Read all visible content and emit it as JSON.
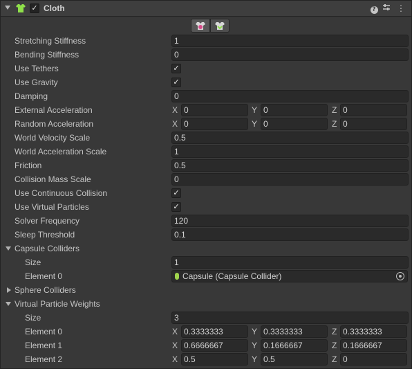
{
  "component": {
    "title": "Cloth",
    "enabled": true,
    "check_glyph": "✓",
    "icons": [
      "cloth-component-icon",
      "help-icon",
      "presets-icon",
      "more-menu-icon"
    ],
    "toolbar": [
      "edit-constraints-icon",
      "edit-self-collision-icon"
    ]
  },
  "axes": {
    "x": "X",
    "y": "Y",
    "z": "Z"
  },
  "props": {
    "stretching_stiffness": {
      "label": "Stretching Stiffness",
      "value": "1"
    },
    "bending_stiffness": {
      "label": "Bending Stiffness",
      "value": "0"
    },
    "use_tethers": {
      "label": "Use Tethers",
      "checked": true
    },
    "use_gravity": {
      "label": "Use Gravity",
      "checked": true
    },
    "damping": {
      "label": "Damping",
      "value": "0"
    },
    "external_acceleration": {
      "label": "External Acceleration",
      "x": "0",
      "y": "0",
      "z": "0"
    },
    "random_acceleration": {
      "label": "Random Acceleration",
      "x": "0",
      "y": "0",
      "z": "0"
    },
    "world_velocity_scale": {
      "label": "World Velocity Scale",
      "value": "0.5"
    },
    "world_acceleration_scale": {
      "label": "World Acceleration Scale",
      "value": "1"
    },
    "friction": {
      "label": "Friction",
      "value": "0.5"
    },
    "collision_mass_scale": {
      "label": "Collision Mass Scale",
      "value": "0"
    },
    "use_continuous_collision": {
      "label": "Use Continuous Collision",
      "checked": true
    },
    "use_virtual_particles": {
      "label": "Use Virtual Particles",
      "checked": true
    },
    "solver_frequency": {
      "label": "Solver Frequency",
      "value": "120"
    },
    "sleep_threshold": {
      "label": "Sleep Threshold",
      "value": "0.1"
    }
  },
  "capsule_colliders": {
    "label": "Capsule Colliders",
    "expanded": true,
    "size_label": "Size",
    "size": "1",
    "elements": [
      {
        "label": "Element 0",
        "value": "Capsule (Capsule Collider)"
      }
    ]
  },
  "sphere_colliders": {
    "label": "Sphere Colliders",
    "expanded": false
  },
  "virtual_particle_weights": {
    "label": "Virtual Particle Weights",
    "expanded": true,
    "size_label": "Size",
    "size": "3",
    "elements": [
      {
        "label": "Element 0",
        "x": "0.3333333",
        "y": "0.3333333",
        "z": "0.3333333"
      },
      {
        "label": "Element 1",
        "x": "0.6666667",
        "y": "0.1666667",
        "z": "0.1666667"
      },
      {
        "label": "Element 2",
        "x": "0.5",
        "y": "0.5",
        "z": "0"
      }
    ]
  },
  "colors": {
    "background": "#383838",
    "field": "#2a2a2a",
    "text": "#c4c4c4",
    "collider_icon": "#9fd34c",
    "cloth_icon": "#8fe04a"
  }
}
